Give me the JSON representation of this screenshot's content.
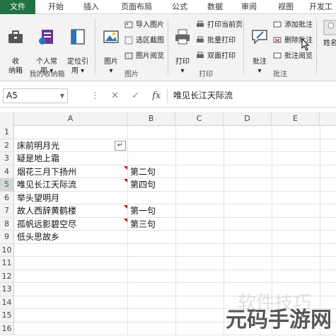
{
  "tabs": [
    "文件",
    "开始",
    "插入",
    "页面布局",
    "公式",
    "数据",
    "审阅",
    "视图",
    "开发工"
  ],
  "ribbon": {
    "groups": {
      "toolbox": {
        "label": "我的收纳箱",
        "buttons": [
          "收\n纳箱",
          "个人常\n用 ▾",
          "定位引\n用 ▾"
        ]
      },
      "picture": {
        "label": "图片",
        "big": "图片\n▾",
        "small": [
          "导入图片",
          "选区截图",
          "图片阅览"
        ]
      },
      "print": {
        "label": "打印",
        "big": "打印\n▾",
        "small": [
          "打印当前页",
          "批量打印",
          "双面打印"
        ]
      },
      "comment": {
        "label": "批注",
        "big": "批注\n▾",
        "small": [
          "添加批注",
          "删除批注",
          "批注阅览"
        ]
      },
      "more": {
        "big": "姓名"
      }
    }
  },
  "formula_bar": {
    "name_box": "A5",
    "value": "唯见长江天际流"
  },
  "grid": {
    "columns": [
      "A",
      "B",
      "C",
      "D",
      "E"
    ],
    "rows": [
      "1",
      "2",
      "3",
      "4",
      "5",
      "6",
      "7",
      "8",
      "9",
      "10",
      "11",
      "12",
      "13",
      "14",
      "15",
      "16"
    ],
    "cells_a": [
      "",
      "床前明月光",
      "疑是地上霜",
      "烟花三月下扬州",
      "唯见长江天际流",
      "举头望明月",
      "故人西辞黄鹤楼",
      "孤帆远影碧空尽",
      "低头思故乡"
    ],
    "cells_b": [
      "",
      "",
      "",
      "第二句",
      "第四句",
      "",
      "第一句",
      "第三句",
      ""
    ],
    "paste_icon": "↵"
  },
  "watermark": {
    "main": "元码手游网",
    "ghost": "软件技巧"
  }
}
